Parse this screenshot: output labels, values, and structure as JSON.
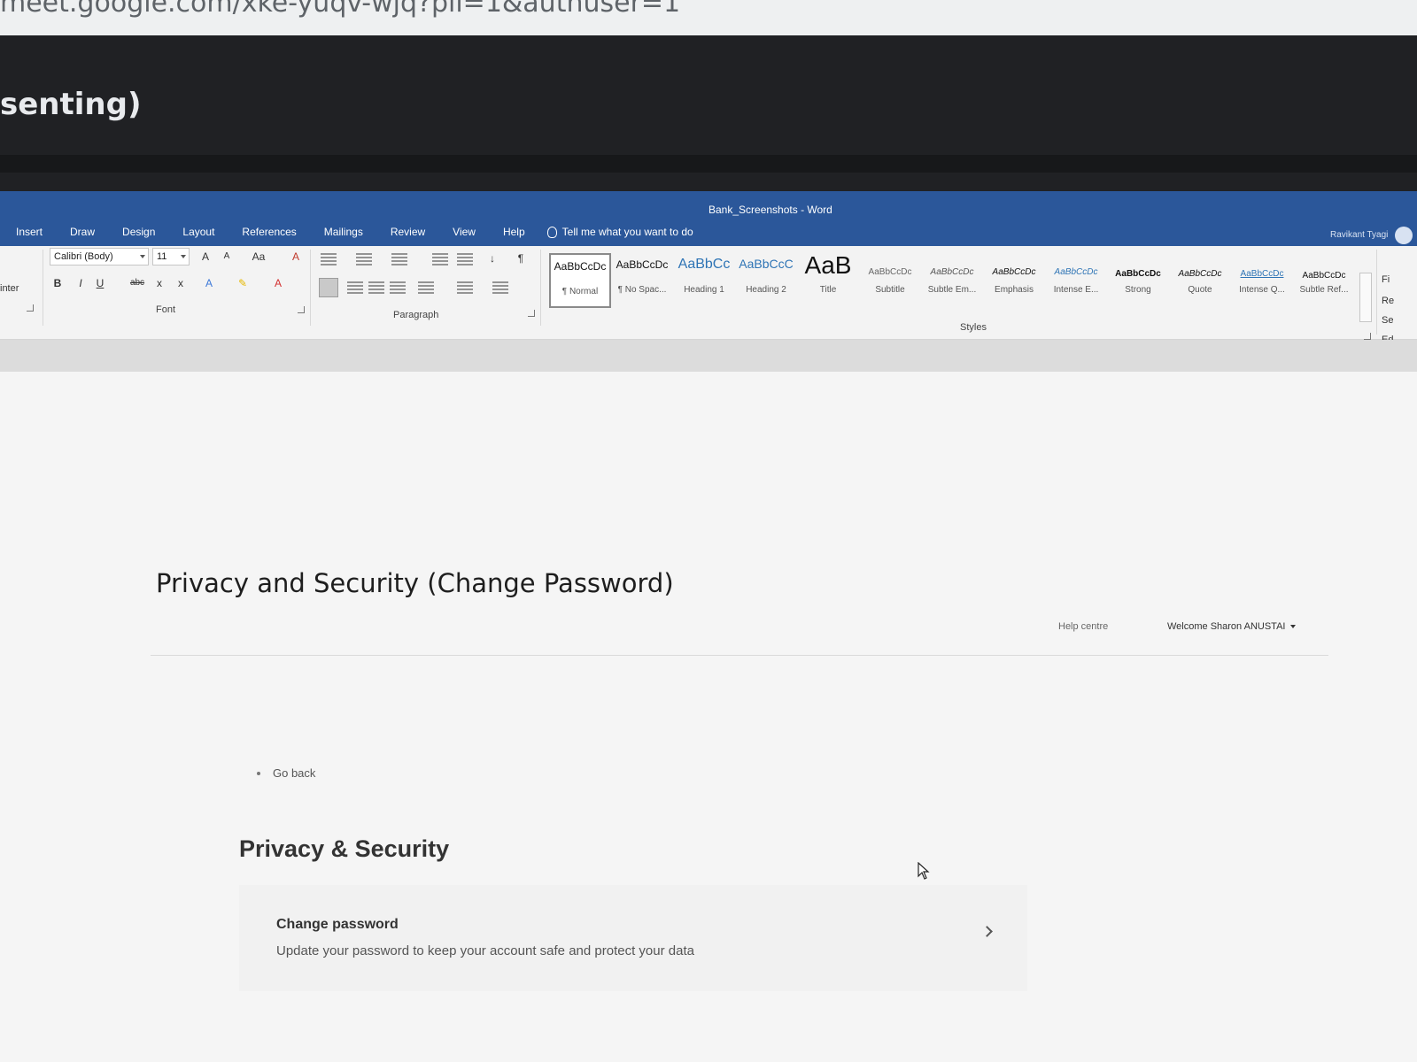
{
  "browser": {
    "url": "meet.google.com/xke-yuqv-wjq?pli=1&authuser=1"
  },
  "meet": {
    "presenting_text": "senting)"
  },
  "word": {
    "doc_title": "Bank_Screenshots - Word",
    "user_name": "Ravikant Tyagi",
    "tabs": [
      "Insert",
      "Draw",
      "Design",
      "Layout",
      "References",
      "Mailings",
      "Review",
      "View",
      "Help"
    ],
    "tell_me": "Tell me what you want to do",
    "clipboard_label": "inter",
    "font_name": "Calibri (Body)",
    "font_size": "11",
    "font_group": "Font",
    "paragraph_group": "Paragraph",
    "styles_group": "Styles",
    "styles": [
      {
        "preview": "AaBbCcDc",
        "name": "¶ Normal"
      },
      {
        "preview": "AaBbCcDc",
        "name": "¶ No Spac..."
      },
      {
        "preview": "AaBbCc",
        "name": "Heading 1"
      },
      {
        "preview": "AaBbCcC",
        "name": "Heading 2"
      },
      {
        "preview": "AaB",
        "name": "Title"
      },
      {
        "preview": "AaBbCcDc",
        "name": "Subtitle"
      },
      {
        "preview": "AaBbCcDc",
        "name": "Subtle Em..."
      },
      {
        "preview": "AaBbCcDc",
        "name": "Emphasis"
      },
      {
        "preview": "AaBbCcDc",
        "name": "Intense E..."
      },
      {
        "preview": "AaBbCcDc",
        "name": "Strong"
      },
      {
        "preview": "AaBbCcDc",
        "name": "Quote"
      },
      {
        "preview": "AaBbCcDc",
        "name": "Intense Q..."
      },
      {
        "preview": "AaBbCcDc",
        "name": "Subtle Ref..."
      }
    ],
    "editing_items": [
      "Fi",
      "Re",
      "Se",
      "Ed"
    ]
  },
  "document": {
    "heading": "Privacy and Security (Change Password)"
  },
  "bank": {
    "help_centre": "Help centre",
    "welcome": "Welcome Sharon ANUSTAI",
    "go_back": "Go back",
    "section_title": "Privacy & Security",
    "change_password_title": "Change password",
    "change_password_desc": "Update your password to keep your account safe and protect your data"
  }
}
